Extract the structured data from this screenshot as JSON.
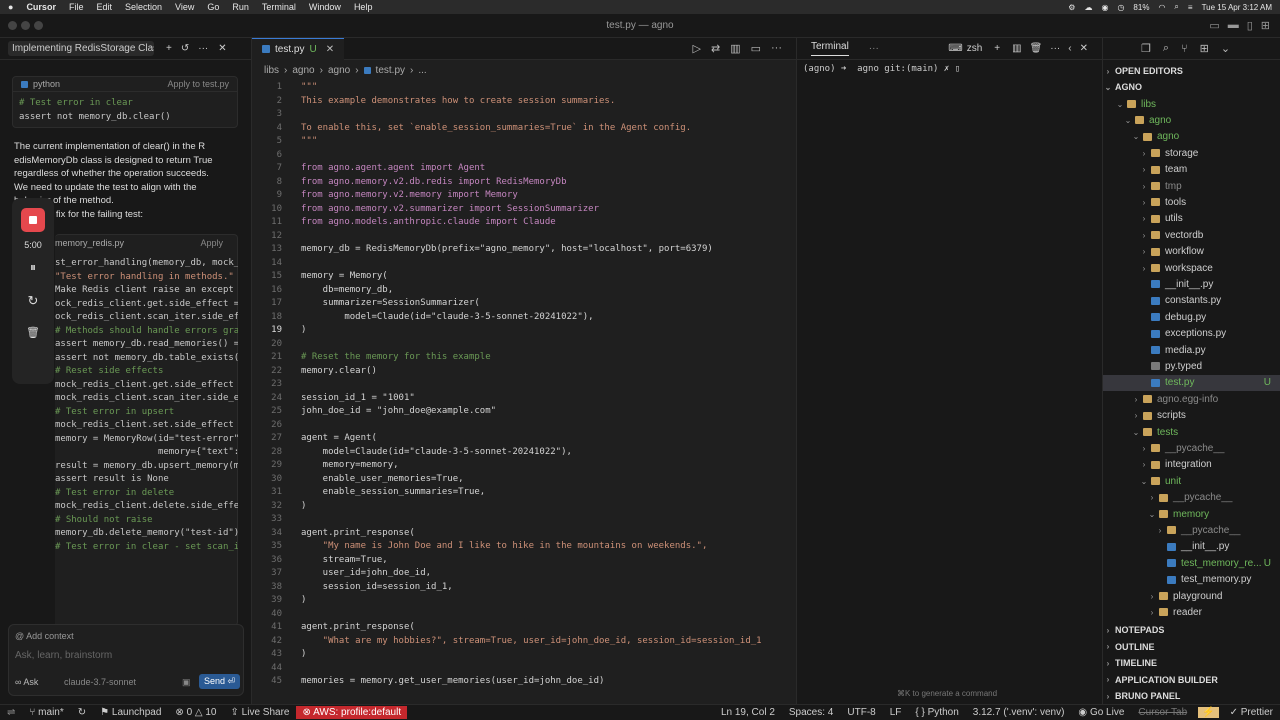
{
  "menubar": {
    "app": "Cursor",
    "items": [
      "File",
      "Edit",
      "Selection",
      "View",
      "Go",
      "Run",
      "Terminal",
      "Window",
      "Help"
    ],
    "battery": "81%",
    "datetime": "Tue 15 Apr  3:12 AM"
  },
  "window": {
    "title": "test.py — agno"
  },
  "chat": {
    "title": "Implementing RedisStorage Clas",
    "block1": {
      "lang": "python",
      "action": "Apply to test.py",
      "lines": [
        "# Test error in clear",
        "assert not memory_db.clear()"
      ]
    },
    "explain": [
      "The current implementation of clear() in the R",
      "edisMemoryDb class is designed to return True",
      "regardless of whether the operation succeeds.",
      "We need to update the test to align with the",
      "behavior of the method."
    ],
    "explain2": "e fix for the failing test:",
    "block2": {
      "file": "memory_redis.py",
      "action": "Apply",
      "lines": [
        "st_error_handling(memory_db, mock_",
        "\"Test error handling in methods.\"",
        "Make Redis client raise an except",
        "ock_redis_client.get.side_effect =",
        "ock_redis_client.scan_iter.side_ef",
        "",
        "# Methods should handle errors grac",
        "assert memory_db.read_memories() ==",
        "assert not memory_db.table_exists()",
        "",
        "# Reset side effects",
        "mock_redis_client.get.side_effect =",
        "mock_redis_client.scan_iter.side_ef",
        "",
        "# Test error in upsert",
        "mock_redis_client.set.side_effect =",
        "memory = MemoryRow(id=\"test-error\",",
        "                   memory={\"text\": '",
        "result = memory_db.upsert_memory(mer",
        "assert result is None",
        "",
        "# Test error in delete",
        "mock_redis_client.delete.side_effect",
        "# Should not raise",
        "memory_db.delete_memory(\"test-id\")",
        "",
        "# Test error in clear - set scan_ite"
      ]
    },
    "recorder": {
      "time": "5:00"
    },
    "add_context": "Add context",
    "input_placeholder": "Ask, learn, brainstorm",
    "mode": "Ask",
    "model": "claude-3.7-sonnet",
    "send": "Send ⏎"
  },
  "editor": {
    "tab": {
      "name": "test.py",
      "status": "U"
    },
    "breadcrumbs": [
      "libs",
      "agno",
      "agno",
      "test.py",
      "..."
    ],
    "lines": [
      {
        "n": "1",
        "t": "\"\"\""
      },
      {
        "n": "2",
        "t": "This example demonstrates how to create session summaries."
      },
      {
        "n": "3",
        "t": ""
      },
      {
        "n": "4",
        "t": "To enable this, set `enable_session_summaries=True` in the Agent config."
      },
      {
        "n": "5",
        "t": "\"\"\""
      },
      {
        "n": "6",
        "t": ""
      },
      {
        "n": "7",
        "t": "from agno.agent.agent import Agent"
      },
      {
        "n": "8",
        "t": "from agno.memory.v2.db.redis import RedisMemoryDb"
      },
      {
        "n": "9",
        "t": "from agno.memory.v2.memory import Memory"
      },
      {
        "n": "10",
        "t": "from agno.memory.v2.summarizer import SessionSummarizer"
      },
      {
        "n": "11",
        "t": "from agno.models.anthropic.claude import Claude"
      },
      {
        "n": "12",
        "t": ""
      },
      {
        "n": "13",
        "t": "memory_db = RedisMemoryDb(prefix=\"agno_memory\", host=\"localhost\", port=6379)"
      },
      {
        "n": "14",
        "t": ""
      },
      {
        "n": "15",
        "t": "memory = Memory("
      },
      {
        "n": "16",
        "t": "    db=memory_db,"
      },
      {
        "n": "17",
        "t": "    summarizer=SessionSummarizer("
      },
      {
        "n": "18",
        "t": "        model=Claude(id=\"claude-3-5-sonnet-20241022\"),"
      },
      {
        "n": "19",
        "t": ")"
      },
      {
        "n": "20",
        "t": ""
      },
      {
        "n": "21",
        "t": "# Reset the memory for this example"
      },
      {
        "n": "22",
        "t": "memory.clear()"
      },
      {
        "n": "23",
        "t": ""
      },
      {
        "n": "24",
        "t": "session_id_1 = \"1001\""
      },
      {
        "n": "25",
        "t": "john_doe_id = \"john_doe@example.com\""
      },
      {
        "n": "26",
        "t": ""
      },
      {
        "n": "27",
        "t": "agent = Agent("
      },
      {
        "n": "28",
        "t": "    model=Claude(id=\"claude-3-5-sonnet-20241022\"),"
      },
      {
        "n": "29",
        "t": "    memory=memory,"
      },
      {
        "n": "30",
        "t": "    enable_user_memories=True,"
      },
      {
        "n": "31",
        "t": "    enable_session_summaries=True,"
      },
      {
        "n": "32",
        "t": ")"
      },
      {
        "n": "33",
        "t": ""
      },
      {
        "n": "34",
        "t": "agent.print_response("
      },
      {
        "n": "35",
        "t": "    \"My name is John Doe and I like to hike in the mountains on weekends.\","
      },
      {
        "n": "36",
        "t": "    stream=True,"
      },
      {
        "n": "37",
        "t": "    user_id=john_doe_id,"
      },
      {
        "n": "38",
        "t": "    session_id=session_id_1,"
      },
      {
        "n": "39",
        "t": ")"
      },
      {
        "n": "40",
        "t": ""
      },
      {
        "n": "41",
        "t": "agent.print_response("
      },
      {
        "n": "42",
        "t": "    \"What are my hobbies?\", stream=True, user_id=john_doe_id, session_id=session_id_1"
      },
      {
        "n": "43",
        "t": ")"
      },
      {
        "n": "44",
        "t": ""
      },
      {
        "n": "45",
        "t": "memories = memory.get_user_memories(user_id=john_doe_id)"
      }
    ]
  },
  "terminal": {
    "tab": "Terminal",
    "shell": "zsh",
    "prompt": "(agno) ➜  agno git:(main) ✗ ▯",
    "hint": "⌘K to generate a command"
  },
  "explorer": {
    "open_editors": "OPEN EDITORS",
    "root": "AGNO",
    "items": [
      {
        "d": 1,
        "label": "libs",
        "open": true,
        "kind": "folder",
        "c": "#6fb85c"
      },
      {
        "d": 2,
        "label": "agno",
        "open": true,
        "kind": "folder",
        "c": "#6fb85c"
      },
      {
        "d": 3,
        "label": "agno",
        "open": true,
        "kind": "folder",
        "c": "#6fb85c"
      },
      {
        "d": 4,
        "label": "storage",
        "open": false,
        "kind": "folder"
      },
      {
        "d": 4,
        "label": "team",
        "open": false,
        "kind": "folder"
      },
      {
        "d": 4,
        "label": "tmp",
        "open": false,
        "kind": "folder",
        "c": "#8a8a8a"
      },
      {
        "d": 4,
        "label": "tools",
        "open": false,
        "kind": "folder"
      },
      {
        "d": 4,
        "label": "utils",
        "open": false,
        "kind": "folder"
      },
      {
        "d": 4,
        "label": "vectordb",
        "open": false,
        "kind": "folder"
      },
      {
        "d": 4,
        "label": "workflow",
        "open": false,
        "kind": "folder"
      },
      {
        "d": 4,
        "label": "workspace",
        "open": false,
        "kind": "folder"
      },
      {
        "d": 4,
        "label": "__init__.py",
        "kind": "py"
      },
      {
        "d": 4,
        "label": "constants.py",
        "kind": "py"
      },
      {
        "d": 4,
        "label": "debug.py",
        "kind": "py"
      },
      {
        "d": 4,
        "label": "exceptions.py",
        "kind": "py"
      },
      {
        "d": 4,
        "label": "media.py",
        "kind": "py"
      },
      {
        "d": 4,
        "label": "py.typed",
        "kind": "file"
      },
      {
        "d": 4,
        "label": "test.py",
        "kind": "py",
        "badge": "U",
        "active": true,
        "c": "#6fb85c"
      },
      {
        "d": 3,
        "label": "agno.egg-info",
        "open": false,
        "kind": "folder",
        "c": "#8a8a8a"
      },
      {
        "d": 3,
        "label": "scripts",
        "open": false,
        "kind": "folder"
      },
      {
        "d": 3,
        "label": "tests",
        "open": true,
        "kind": "folder",
        "c": "#6fb85c"
      },
      {
        "d": 4,
        "label": "__pycache__",
        "open": false,
        "kind": "folder",
        "c": "#8a8a8a"
      },
      {
        "d": 4,
        "label": "integration",
        "open": false,
        "kind": "folder"
      },
      {
        "d": 4,
        "label": "unit",
        "open": true,
        "kind": "folder",
        "c": "#6fb85c"
      },
      {
        "d": 5,
        "label": "__pycache__",
        "open": false,
        "kind": "folder",
        "c": "#8a8a8a"
      },
      {
        "d": 5,
        "label": "memory",
        "open": true,
        "kind": "folder",
        "c": "#6fb85c"
      },
      {
        "d": 6,
        "label": "__pycache__",
        "open": false,
        "kind": "folder",
        "c": "#8a8a8a"
      },
      {
        "d": 6,
        "label": "__init__.py",
        "kind": "py"
      },
      {
        "d": 6,
        "label": "test_memory_re...",
        "kind": "py",
        "badge": "U",
        "c": "#6fb85c"
      },
      {
        "d": 6,
        "label": "test_memory.py",
        "kind": "py"
      },
      {
        "d": 5,
        "label": "playground",
        "open": false,
        "kind": "folder"
      },
      {
        "d": 5,
        "label": "reader",
        "open": false,
        "kind": "folder"
      }
    ],
    "sections": [
      "NOTEPADS",
      "OUTLINE",
      "TIMELINE",
      "APPLICATION BUILDER",
      "BRUNO PANEL"
    ]
  },
  "statusbar": {
    "branch": "main*",
    "launchpad": "Launchpad",
    "problems": "0",
    "warnings": "10",
    "liveshare": "Live Share",
    "aws": "AWS: profile:default",
    "position": "Ln 19, Col 2",
    "spaces": "Spaces: 4",
    "encoding": "UTF-8",
    "eol": "LF",
    "language": "Python",
    "interpreter": "3.12.7 ('.venv': venv)",
    "golive": "Go Live",
    "cursortab": "Cursor Tab",
    "prettier": "Prettier"
  }
}
